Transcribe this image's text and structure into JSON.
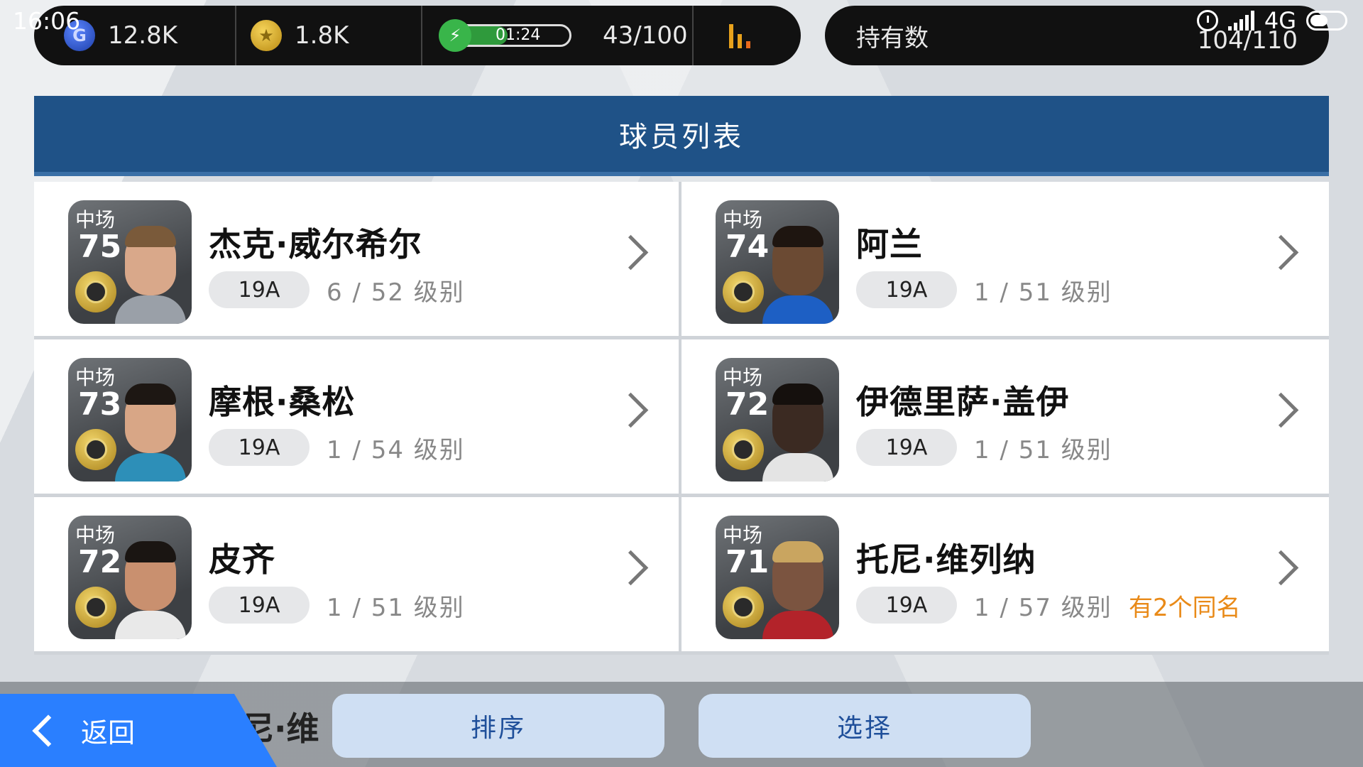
{
  "status": {
    "time": "16:06",
    "network": "4G"
  },
  "currency": {
    "gp": "12.8K",
    "gp_icon": "G",
    "coins": "1.8K",
    "coin_icon": "★",
    "energy_timer": "01:24",
    "energy_progress": 0.5,
    "energy_count": "43/100"
  },
  "holdings": {
    "label": "持有数",
    "count": "104/110"
  },
  "header": {
    "title": "球员列表"
  },
  "players": [
    {
      "pos": "中场",
      "ovr": "75",
      "name": "杰克·威尔希尔",
      "version": "19A",
      "level": "6 / 52 级别",
      "dup": ""
    },
    {
      "pos": "中场",
      "ovr": "74",
      "name": "阿兰",
      "version": "19A",
      "level": "1 / 51 级别",
      "dup": ""
    },
    {
      "pos": "中场",
      "ovr": "73",
      "name": "摩根·桑松",
      "version": "19A",
      "level": "1 / 54 级别",
      "dup": ""
    },
    {
      "pos": "中场",
      "ovr": "72",
      "name": "伊德里萨·盖伊",
      "version": "19A",
      "level": "1 / 51 级别",
      "dup": ""
    },
    {
      "pos": "中场",
      "ovr": "72",
      "name": "皮齐",
      "version": "19A",
      "level": "1 / 51 级别",
      "dup": ""
    },
    {
      "pos": "中场",
      "ovr": "71",
      "name": "托尼·维列纳",
      "version": "19A",
      "level": "1 / 57 级别",
      "dup": "有2个同名"
    }
  ],
  "peek_name": "尼·维",
  "buttons": {
    "back": "返回",
    "sort": "排序",
    "select": "选择"
  },
  "colors": {
    "header_bg": "#1f5287",
    "back_bg": "#2a7fff",
    "dup_text": "#e98a18"
  }
}
